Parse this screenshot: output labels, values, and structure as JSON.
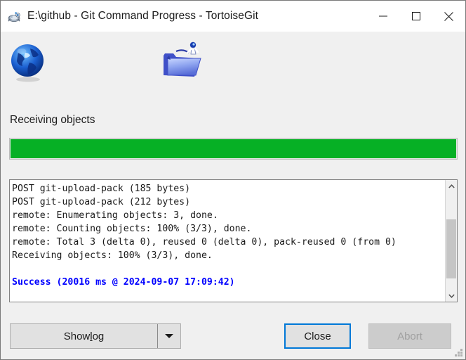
{
  "window": {
    "title": "E:\\github - Git Command Progress - TortoiseGit",
    "icon": "tortoisegit-turtle-icon",
    "controls": {
      "minimize": "Minimize",
      "maximize": "Maximize",
      "close": "Close"
    }
  },
  "progress_panel": {
    "globe_icon": "globe-icon",
    "folder_icon": "folder-transfer-icon",
    "status_label": "Receiving objects",
    "progress_percent": 100,
    "progress_color": "#06b025"
  },
  "log": {
    "lines": [
      {
        "text": "POST git-upload-pack (185 bytes)",
        "style": "normal"
      },
      {
        "text": "POST git-upload-pack (212 bytes)",
        "style": "normal"
      },
      {
        "text": "remote: Enumerating objects: 3, done.",
        "style": "normal"
      },
      {
        "text": "remote: Counting objects: 100% (3/3), done.",
        "style": "normal"
      },
      {
        "text": "remote: Total 3 (delta 0), reused 0 (delta 0), pack-reused 0 (from 0)",
        "style": "normal"
      },
      {
        "text": "Receiving objects: 100% (3/3), done.",
        "style": "normal"
      },
      {
        "text": "",
        "style": "blank"
      },
      {
        "text": "Success (20016 ms @ 2024-09-07 17:09:42)",
        "style": "success"
      }
    ],
    "success_color": "#0000ff",
    "scrollbar": {
      "up_arrow": "chevron-up-icon",
      "down_arrow": "chevron-down-icon"
    }
  },
  "buttons": {
    "show_log": {
      "label_before": "Show ",
      "label_accel": "l",
      "label_after": "og",
      "dropdown_icon": "caret-down-icon"
    },
    "close": "Close",
    "abort": "Abort"
  },
  "resize_grip": "resize-grip-icon"
}
